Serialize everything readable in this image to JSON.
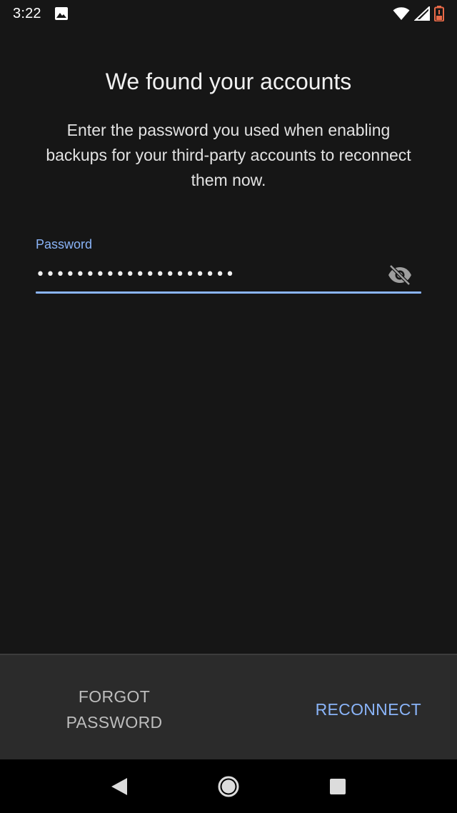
{
  "status_bar": {
    "time": "3:22",
    "icons": [
      "image-notification-icon",
      "wifi-icon",
      "signal-icon",
      "battery-low-icon"
    ]
  },
  "screen": {
    "title": "We found your accounts",
    "description": "Enter the password you used when enabling backups for your third-party accounts to reconnect them now."
  },
  "password_field": {
    "label": "Password",
    "value": "••••••••••••••••••••",
    "toggle_icon": "visibility-off-icon",
    "accent_color": "#8ab4f8"
  },
  "actions": {
    "forgot_label": "FORGOT PASSWORD",
    "reconnect_label": "RECONNECT"
  },
  "navigation": {
    "icons": [
      "back-icon",
      "home-icon",
      "recents-icon"
    ]
  },
  "colors": {
    "background": "#161616",
    "action_bar": "#2b2b2b",
    "accent": "#8ab4f8",
    "battery": "#ea6a48"
  }
}
